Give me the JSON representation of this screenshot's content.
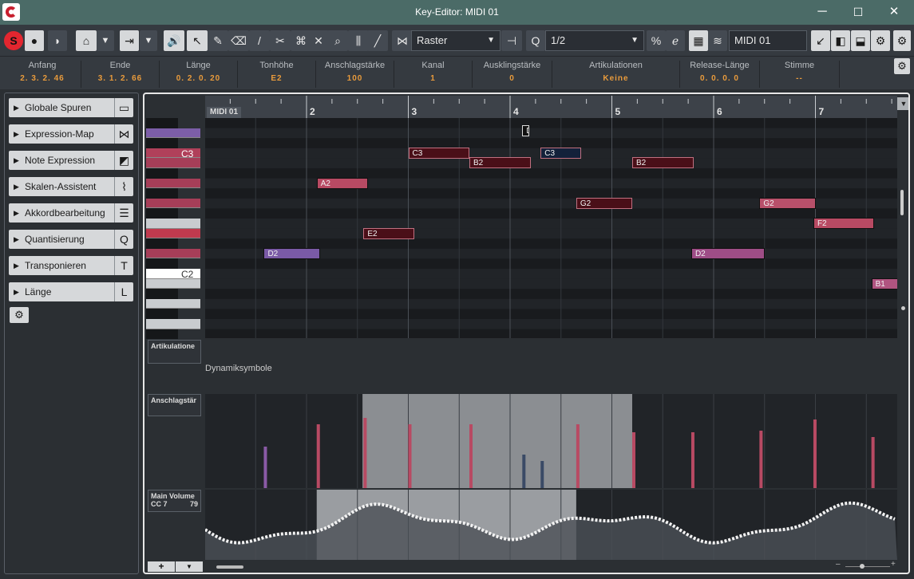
{
  "window": {
    "title": "Key-Editor: MIDI 01",
    "minimize": "─",
    "maximize": "☐",
    "close": "✕"
  },
  "toolbar": {
    "raster": "Raster",
    "quantize": "1/2",
    "track": "MIDI 01",
    "solo": "S"
  },
  "infoline": [
    {
      "label": "Anfang",
      "value": "2. 3. 2. 46"
    },
    {
      "label": "Ende",
      "value": "3. 1. 2. 66"
    },
    {
      "label": "Länge",
      "value": "0. 2. 0. 20"
    },
    {
      "label": "Tonhöhe",
      "value": "E2"
    },
    {
      "label": "Anschlagstärke",
      "value": "100"
    },
    {
      "label": "Kanal",
      "value": "1"
    },
    {
      "label": "Ausklingstärke",
      "value": "0"
    },
    {
      "label": "Artikulationen",
      "value": "Keine"
    },
    {
      "label": "Release-Länge",
      "value": "0. 0. 0. 0"
    },
    {
      "label": "Stimme",
      "value": "--"
    }
  ],
  "sections": [
    {
      "label": "Globale Spuren",
      "icon": "▭"
    },
    {
      "label": "Expression-Map",
      "icon": "⋈"
    },
    {
      "label": "Note Expression",
      "icon": "◩"
    },
    {
      "label": "Skalen-Assistent",
      "icon": "⌇"
    },
    {
      "label": "Akkordbearbeitung",
      "icon": "☰"
    },
    {
      "label": "Quantisierung",
      "icon": "Q"
    },
    {
      "label": "Transponieren",
      "icon": "T"
    },
    {
      "label": "Länge",
      "icon": "L"
    }
  ],
  "ruler": {
    "part": "MIDI 01",
    "bars": [
      "2",
      "3",
      "4",
      "5",
      "6",
      "7"
    ]
  },
  "piano": {
    "c3": "C3",
    "c2": "C2"
  },
  "notes": [
    {
      "name": "C3",
      "bar": 3,
      "len": 0.6
    },
    {
      "name": "B2",
      "bar": 3.6,
      "len": 0.6
    },
    {
      "name": "C3",
      "bar": 4.3,
      "len": 0.4
    },
    {
      "name": "B2",
      "bar": 5.2,
      "len": 0.6
    },
    {
      "name": "A2",
      "bar": 2.1,
      "len": 0.5
    },
    {
      "name": "G2",
      "bar": 4.65,
      "len": 0.55
    },
    {
      "name": "G2",
      "bar": 6.45,
      "len": 0.55
    },
    {
      "name": "F2",
      "bar": 6.98,
      "len": 0.6
    },
    {
      "name": "E2",
      "bar": 2.56,
      "len": 0.5
    },
    {
      "name": "D2",
      "bar": 1.58,
      "len": 0.55
    },
    {
      "name": "D2",
      "bar": 5.78,
      "len": 0.72
    },
    {
      "name": "B1",
      "bar": 7.55,
      "len": 0.3
    },
    {
      "name": "D",
      "bar": 4.12,
      "len": 0.07
    }
  ],
  "lanes": {
    "artik": "Artikulatione",
    "dyn": "Dynamiksymbole",
    "vel": "Anschlagstär",
    "cc": "Main Volume",
    "cc_num": "CC 7",
    "cc_val": "79"
  },
  "bottom": {
    "add": "+",
    "menu": "▼",
    "minus": "–",
    "plus": "+"
  }
}
